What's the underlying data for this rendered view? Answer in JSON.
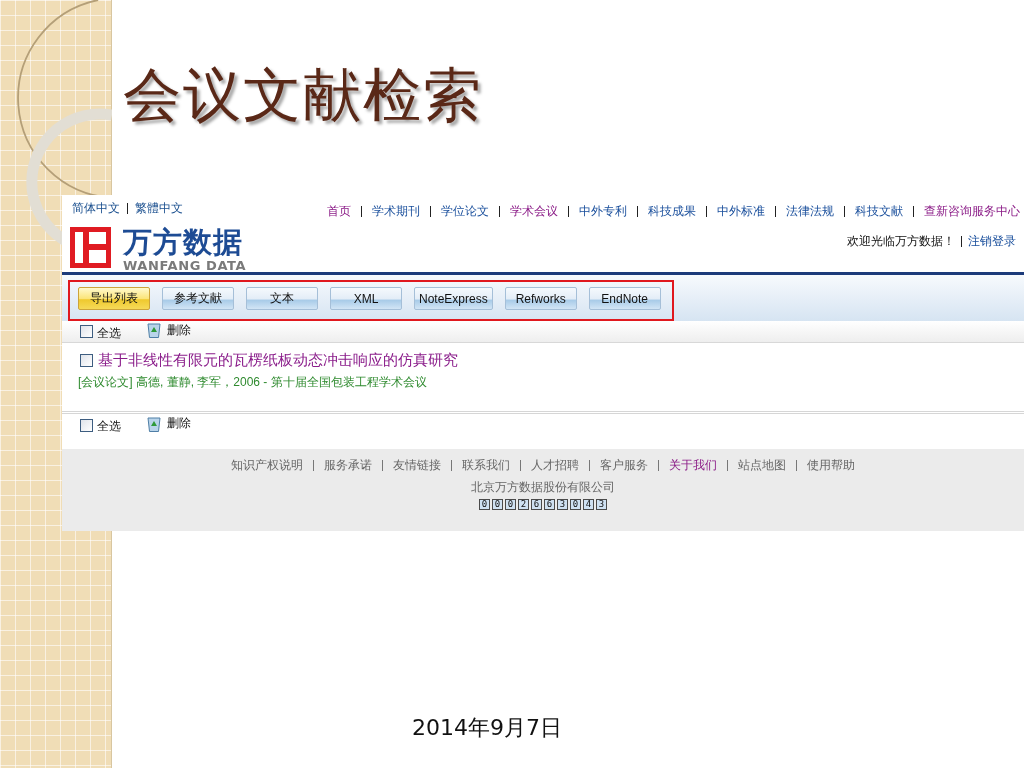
{
  "slide": {
    "title": "会议文献检索",
    "date": "2014年9月7日"
  },
  "header": {
    "languages": [
      {
        "label": "简体中文"
      },
      {
        "label": "繁體中文"
      }
    ],
    "logo": {
      "name": "万方数据",
      "subtitle": "WANFANG DATA"
    },
    "nav": [
      {
        "label": "首页",
        "visited": true
      },
      {
        "label": "学术期刊",
        "visited": false
      },
      {
        "label": "学位论文",
        "visited": false
      },
      {
        "label": "学术会议",
        "visited": true
      },
      {
        "label": "中外专利",
        "visited": false
      },
      {
        "label": "科技成果",
        "visited": false
      },
      {
        "label": "中外标准",
        "visited": false
      },
      {
        "label": "法律法规",
        "visited": false
      },
      {
        "label": "科技文献",
        "visited": false
      },
      {
        "label": "查新咨询服务中心",
        "visited": true
      }
    ],
    "welcome": "欢迎光临万方数据！",
    "logout": "注销登录"
  },
  "export_toolbar": [
    {
      "label": "导出列表",
      "selected": true
    },
    {
      "label": "参考文献",
      "selected": false
    },
    {
      "label": "文本",
      "selected": false
    },
    {
      "label": "XML",
      "selected": false
    },
    {
      "label": "NoteExpress",
      "selected": false
    },
    {
      "label": "Refworks",
      "selected": false
    },
    {
      "label": "EndNote",
      "selected": false
    }
  ],
  "top_actions": {
    "select_all": {
      "label": "全选",
      "checked": false
    },
    "delete": "删除"
  },
  "results": [
    {
      "checked": false,
      "title": "基于非线性有限元的瓦楞纸板动态冲击响应的仿真研究",
      "meta": "[会议论文] 高德, 董静, 李军，2006 - 第十届全国包装工程学术会议"
    }
  ],
  "bottom_actions": {
    "select_all": {
      "label": "全选",
      "checked": false
    },
    "delete": "删除"
  },
  "footer": {
    "links": [
      {
        "label": "知识产权说明",
        "visited": false
      },
      {
        "label": "服务承诺",
        "visited": false
      },
      {
        "label": "友情链接",
        "visited": false
      },
      {
        "label": "联系我们",
        "visited": false
      },
      {
        "label": "人才招聘",
        "visited": false
      },
      {
        "label": "客户服务",
        "visited": false
      },
      {
        "label": "关于我们",
        "visited": true
      },
      {
        "label": "站点地图",
        "visited": false
      },
      {
        "label": "使用帮助",
        "visited": false
      }
    ],
    "company": "北京万方数据股份有限公司",
    "counter": [
      "0",
      "0",
      "0",
      "2",
      "6",
      "6",
      "3",
      "0",
      "4",
      "3"
    ]
  }
}
